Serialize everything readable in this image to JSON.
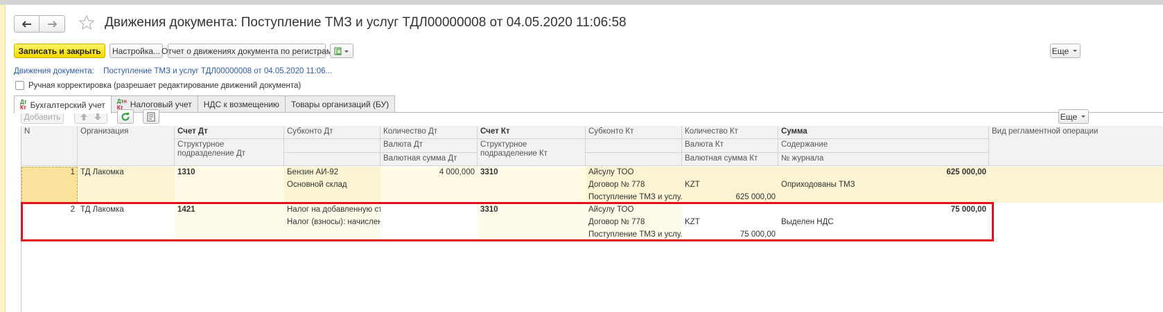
{
  "window": {
    "title": "Движения документа: Поступление ТМЗ и услуг ТДЛ00000008 от 04.05.2020 11:06:58"
  },
  "toolbar": {
    "save_close": "Записать и закрыть",
    "settings": "Настройка...",
    "report": "Отчет о движениях документа по регистрам",
    "more": "Еще"
  },
  "doc_link": {
    "label": "Движения документа:",
    "value": "Поступление ТМЗ и услуг ТДЛ00000008 от 04.05.2020 11:06..."
  },
  "manual_correction": {
    "label": "Ручная корректировка (разрешает редактирование движений документа)"
  },
  "tabs": [
    {
      "label": "Бухгалтерский учет",
      "active": true
    },
    {
      "label": "Налоговый учет",
      "active": false
    },
    {
      "label": "НДС к возмещению",
      "active": false
    },
    {
      "label": "Товары организаций (БУ)",
      "active": false
    }
  ],
  "dtkt_icon": {
    "dt": "Дт",
    "kt": "Кт",
    "n": "Н"
  },
  "table_toolbar": {
    "add": "Добавить",
    "more": "Еще"
  },
  "columns": {
    "n": "N",
    "org": "Организация",
    "acc_dt": "Счет Дт",
    "dept_dt": "Структурное подразделение Дт",
    "sub_dt": "Субконто Дт",
    "qty_dt": "Количество Дт",
    "cur_dt": "Валюта Дт",
    "cur_sum_dt": "Валютная сумма Дт",
    "acc_kt": "Счет Кт",
    "dept_kt": "Структурное подразделение Кт",
    "sub_kt": "Субконто Кт",
    "qty_kt": "Количество Кт",
    "cur_kt": "Валюта Кт",
    "cur_sum_kt": "Валютная сумма Кт",
    "sum": "Сумма",
    "content": "Содержание",
    "journal": "№ журнала",
    "op_type": "Вид регламентной операции"
  },
  "rows": [
    {
      "n": "1",
      "org": "ТД Лакомка",
      "acc_dt": "1310",
      "sub_dt_1": "Бензин АИ-92",
      "sub_dt_2": "Основной склад",
      "qty_dt": "4 000,000",
      "acc_kt": "3310",
      "sub_kt_1": "Айсулу ТОО",
      "sub_kt_2": "Договор № 778",
      "sub_kt_3": "Поступление ТМЗ и услу...",
      "cur_kt": "KZT",
      "cur_sum_kt": "625 000,00",
      "sum": "625 000,00",
      "content": "Оприходованы ТМЗ"
    },
    {
      "n": "2",
      "org": "ТД Лакомка",
      "acc_dt": "1421",
      "sub_dt_1": "Налог на добавленную ст...",
      "sub_dt_2": "Налог (взносы): начислен...",
      "acc_kt": "3310",
      "sub_kt_1": "Айсулу ТОО",
      "sub_kt_2": "Договор № 778",
      "sub_kt_3": "Поступление ТМЗ и услу...",
      "cur_kt": "KZT",
      "cur_sum_kt": "75 000,00",
      "sum": "75 000,00",
      "content": "Выделен НДС"
    }
  ],
  "colors": {
    "primary_button": "#f2d700",
    "link": "#2d5ca8",
    "highlight_frame": "#e0101c",
    "selected_row": "#fcf3d3"
  }
}
